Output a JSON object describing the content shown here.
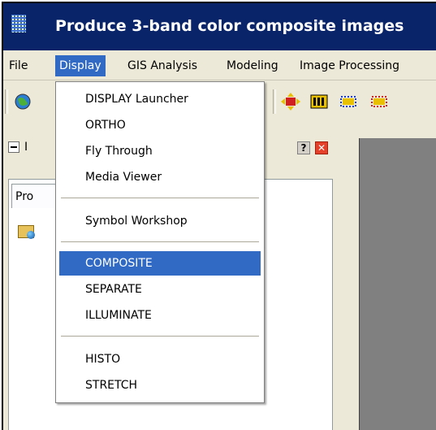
{
  "window": {
    "title": "Produce 3-band color composite images"
  },
  "menubar": {
    "items": [
      {
        "label": "File"
      },
      {
        "label": "Display"
      },
      {
        "label": "GIS Analysis"
      },
      {
        "label": "Modeling"
      },
      {
        "label": "Image Processing"
      }
    ],
    "active": "Display"
  },
  "panel": {
    "header_text": "I",
    "help_label": "?",
    "close_label": "✕",
    "tab_label": "Pro"
  },
  "dropdown": {
    "groups": [
      [
        "DISPLAY Launcher",
        "ORTHO",
        "Fly Through",
        "Media Viewer"
      ],
      [
        "Symbol Workshop"
      ],
      [
        "COMPOSITE",
        "SEPARATE",
        "ILLUMINATE"
      ],
      [
        "HISTO",
        "STRETCH"
      ]
    ],
    "selected": "COMPOSITE"
  },
  "icons": [
    "app-icon",
    "globe-icon",
    "move-icon",
    "image-stack-icon",
    "select-region-icon",
    "select-region-2-icon",
    "folder-globe-icon"
  ],
  "colors": {
    "titlebar": "#0a246a",
    "selection": "#316ac5",
    "canvas": "#808080",
    "window_bg": "#ece9d8"
  }
}
